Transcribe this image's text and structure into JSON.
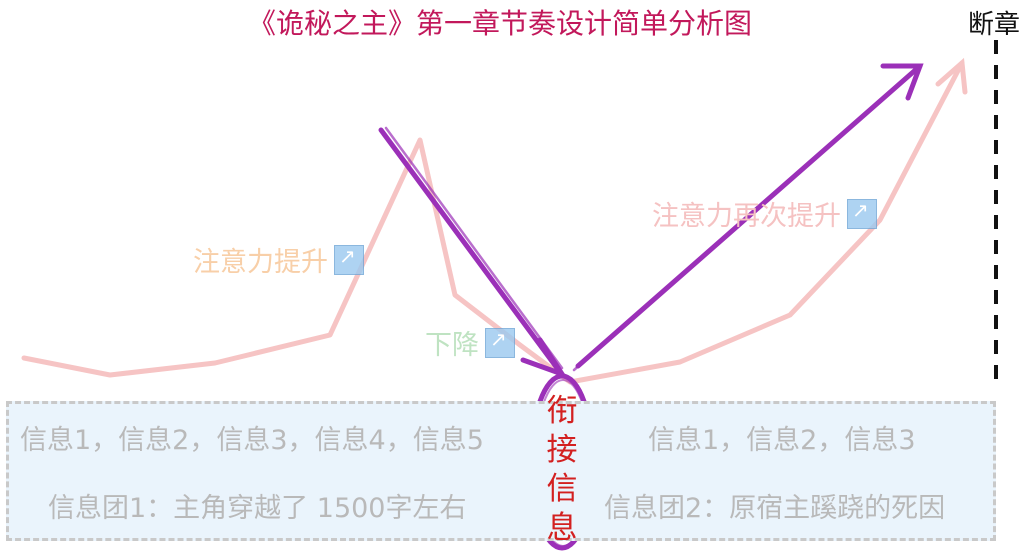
{
  "title": "《诡秘之主》第一章节奏设计简单分析图",
  "breakpoint_label": "断章",
  "curve": {
    "rise1_label": "注意力提升",
    "drop_label": "下降",
    "rise2_label": "注意力再次提升"
  },
  "bridge": {
    "chars": [
      "衔",
      "接",
      "信",
      "息"
    ]
  },
  "info": {
    "left_items": "信息1，信息2，信息3，信息4，信息5",
    "left_group": "信息团1：主角穿越了 1500字左右",
    "right_items": "信息1，信息2，信息3",
    "right_group": "信息团2：原宿主蹊跷的死因"
  },
  "colors": {
    "title": "#c2185b",
    "curve": "#f6c4c4",
    "arrow": "#9b30b8",
    "bridge_text": "#d32020",
    "info_box_bg": "#eaf4fc"
  },
  "icons": [
    "arrow-up-right-icon",
    "arrow-down-right-icon"
  ]
}
